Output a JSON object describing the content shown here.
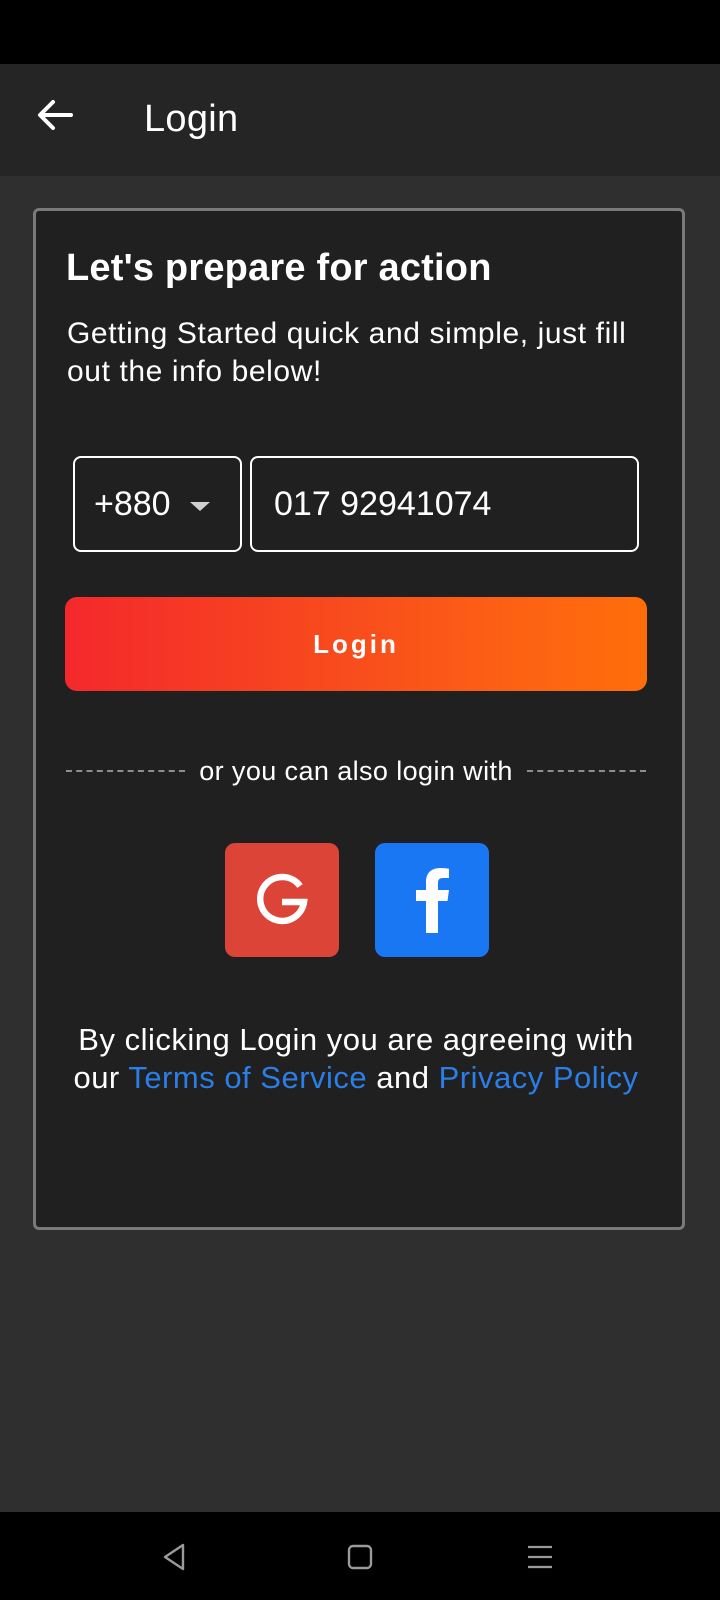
{
  "app_bar": {
    "title": "Login",
    "back_icon": "arrow-left-icon"
  },
  "card": {
    "heading": "Let's prepare for action",
    "subtitle": "Getting Started quick and simple, just fill out the info below!",
    "country_code": {
      "selected": "+880",
      "icon": "caret-down-icon"
    },
    "phone": {
      "value": "017 92941074"
    },
    "login_button": "Login",
    "divider_text": "or you can also login with",
    "social": {
      "google_icon": "google-g-icon",
      "facebook_icon": "facebook-f-icon",
      "google_color": "#dc4438",
      "facebook_color": "#1977f3"
    },
    "legal": {
      "text_before": "By clicking Login you are agreeing with our ",
      "terms_link": "Terms of Service",
      "text_between": " and ",
      "privacy_link": "Privacy Policy"
    }
  },
  "nav_bar": {
    "back_icon": "triangle-back-icon",
    "home_icon": "square-home-icon",
    "menu_icon": "three-lines-menu-icon"
  },
  "colors": {
    "background": "#2f2f2f",
    "app_bar": "#252525",
    "card": "#202020",
    "gradient_start": "#f4282c",
    "gradient_end": "#ff6d0a",
    "link": "#2a7ee8"
  }
}
